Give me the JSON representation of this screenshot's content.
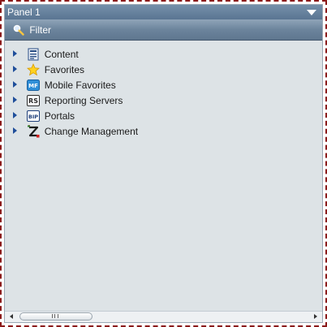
{
  "panel": {
    "title": "Panel 1"
  },
  "filter": {
    "label": "Filter"
  },
  "tree": {
    "items": [
      {
        "label": "Content",
        "icon": "content-icon"
      },
      {
        "label": "Favorites",
        "icon": "star-icon"
      },
      {
        "label": "Mobile Favorites",
        "icon": "mobile-favorites-icon",
        "badge": "MF"
      },
      {
        "label": "Reporting Servers",
        "icon": "reporting-servers-icon",
        "badge": "RS"
      },
      {
        "label": "Portals",
        "icon": "portals-icon",
        "badge": "BIP"
      },
      {
        "label": "Change Management",
        "icon": "change-management-icon"
      }
    ]
  },
  "colors": {
    "header": "#6a84a0",
    "panel_background": "#dde3e6",
    "border_dashed": "#8b1a1a",
    "expander": "#1f4e9a"
  }
}
